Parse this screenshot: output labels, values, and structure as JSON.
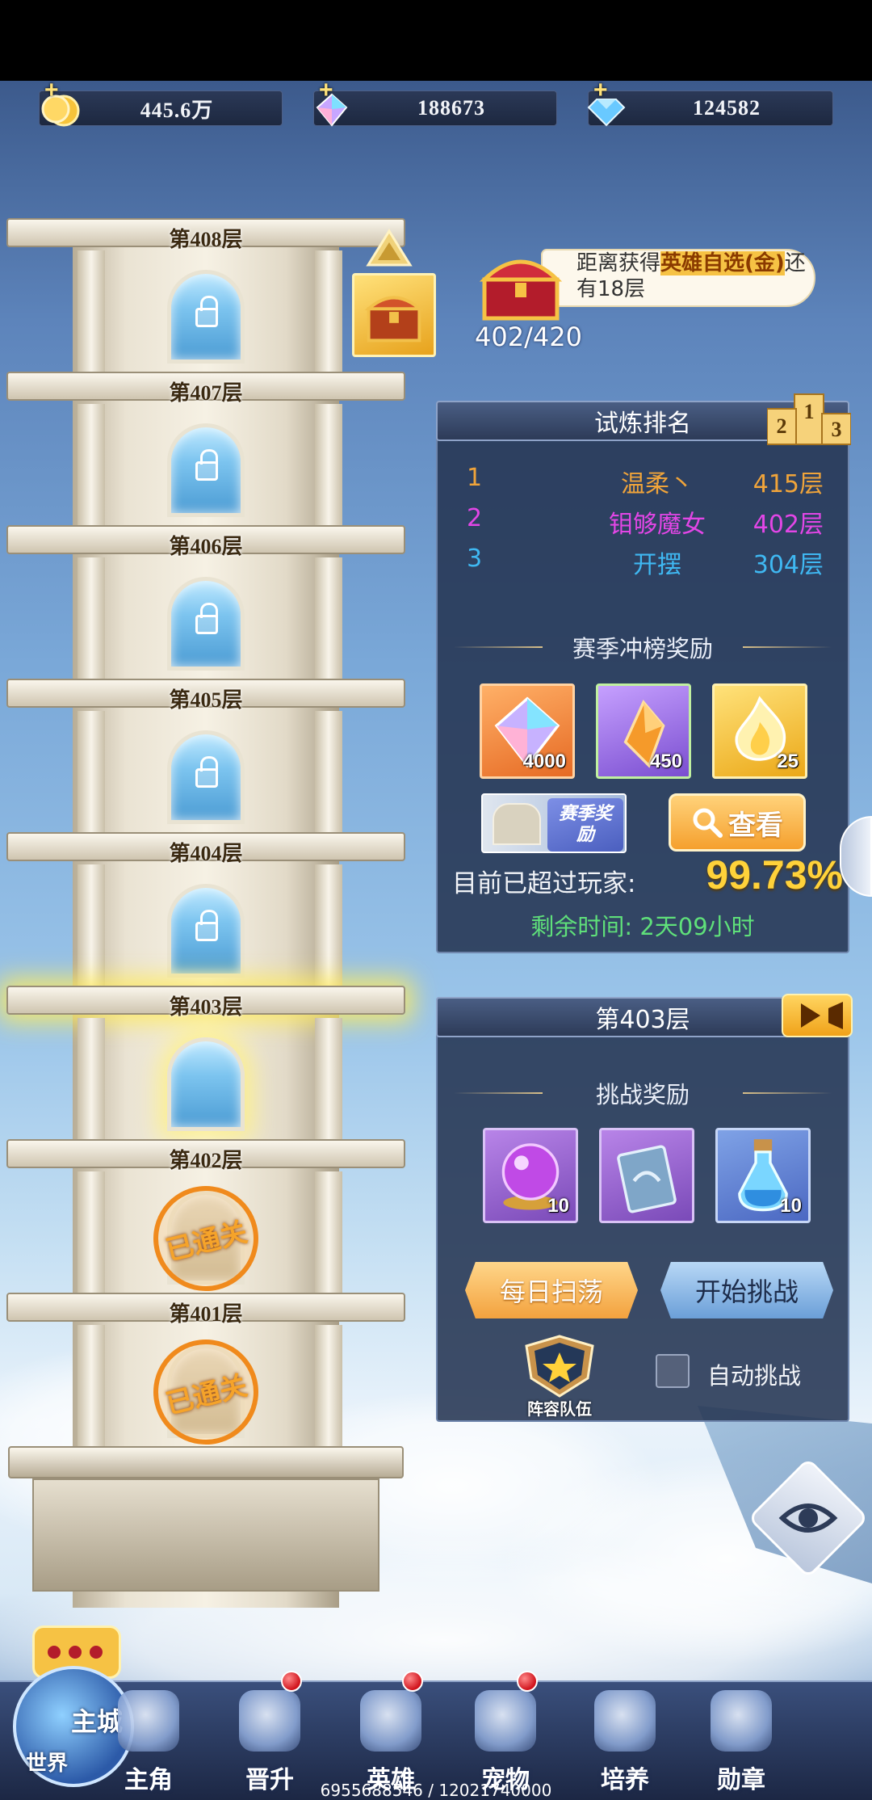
{
  "currencies": [
    {
      "name": "gold",
      "amount": "445.6万",
      "icon": "gold-coin-icon"
    },
    {
      "name": "gem-purple",
      "amount": "188673",
      "icon": "rainbow-gem-icon"
    },
    {
      "name": "gem-blue",
      "amount": "124582",
      "icon": "blue-diamond-icon"
    }
  ],
  "tower": {
    "floors": [
      {
        "label": "第408层",
        "status": "locked"
      },
      {
        "label": "第407层",
        "status": "locked"
      },
      {
        "label": "第406层",
        "status": "locked"
      },
      {
        "label": "第405层",
        "status": "locked"
      },
      {
        "label": "第404层",
        "status": "locked"
      },
      {
        "label": "第403层",
        "status": "current"
      },
      {
        "label": "第402层",
        "status": "cleared"
      },
      {
        "label": "第401层",
        "status": "cleared"
      }
    ],
    "cleared_text": "已通关"
  },
  "milestone": {
    "text_prefix": "距离获得",
    "reward_name": "英雄自选(金)",
    "text_suffix": "还有18层",
    "progress_text": "402/420",
    "progress_fraction": 0.957
  },
  "ranking": {
    "title": "试炼排名",
    "rows": [
      {
        "rank": "1",
        "name": "温柔丶",
        "floor": "415层",
        "color": "#f0a43a"
      },
      {
        "rank": "2",
        "name": "钼够魔女",
        "floor": "402层",
        "color": "#e246e6"
      },
      {
        "rank": "3",
        "name": "开摆",
        "floor": "304层",
        "color": "#3fb8f2"
      }
    ],
    "season_title": "赛季冲榜奖励",
    "season_rewards": [
      {
        "icon": "rainbow-gem-icon",
        "count": "4000"
      },
      {
        "icon": "amber-crystal-icon",
        "count": "450"
      },
      {
        "icon": "golden-flame-icon",
        "count": "25"
      }
    ],
    "season_banner_text": "赛季奖励",
    "view_button": "查看",
    "percent_label": "目前已超过玩家:",
    "percent_value": "99.73%",
    "time_label": "剩余时间: 2天09小时"
  },
  "floor_panel": {
    "title": "第403层",
    "reward_title": "挑战奖励",
    "rewards": [
      {
        "icon": "purple-orb-icon",
        "count": "10"
      },
      {
        "icon": "skill-card-icon",
        "count": ""
      },
      {
        "icon": "blue-potion-icon",
        "count": "10"
      }
    ],
    "sweep_button": "每日扫荡",
    "challenge_button": "开始挑战",
    "team_label": "阵容队伍",
    "auto_label": "自动挑战",
    "auto_checked": false
  },
  "nav": {
    "world_label": "世界",
    "city_label": "主城",
    "items": [
      {
        "label": "主角",
        "icon": "hero-profile-icon",
        "badge": false
      },
      {
        "label": "晋升",
        "icon": "promotion-icon",
        "badge": true
      },
      {
        "label": "英雄",
        "icon": "helmet-icon",
        "badge": true
      },
      {
        "label": "宠物",
        "icon": "pet-icon",
        "badge": true
      },
      {
        "label": "培养",
        "icon": "training-icon",
        "badge": false
      },
      {
        "label": "勋章",
        "icon": "medal-icon",
        "badge": false
      }
    ]
  },
  "footer_id": "6955688546 / 12021740000"
}
